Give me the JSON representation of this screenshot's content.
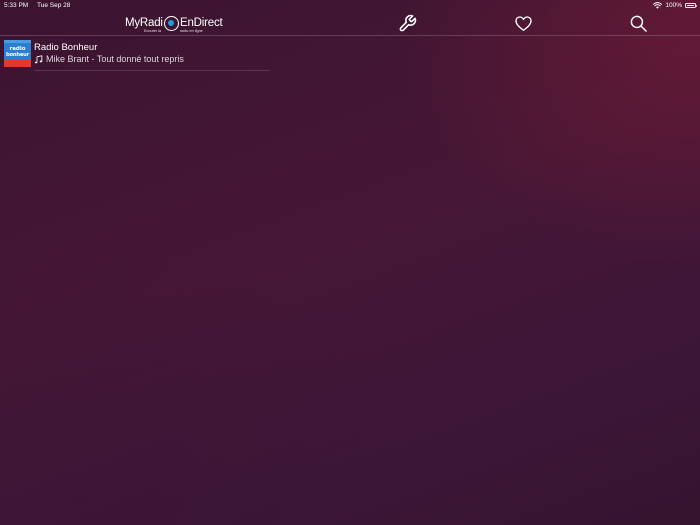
{
  "status_bar": {
    "time": "5:33 PM",
    "date": "Tue Sep 28",
    "battery": "100%",
    "battery_level": 1.0
  },
  "app": {
    "logo_left": "MyRadi",
    "logo_right": "EnDirect",
    "logo_sub_left": "Ecouter la",
    "logo_sub_right": "radio en ligne",
    "accent": "#1e9ce0"
  },
  "nav": {
    "icons": [
      "wrench-icon",
      "heart-icon",
      "search-icon"
    ]
  },
  "stations": [
    {
      "name": "Radio Bonheur",
      "logo_text_1": "radio",
      "logo_text_2": "bonheur",
      "now_playing": "Mike Brant - Tout donné tout repris",
      "logo_colors": {
        "main": "#2a7fd0",
        "bottom": "#e03a2c"
      }
    }
  ],
  "colors": {
    "background": "#3e1534",
    "text": "#ffffff"
  }
}
